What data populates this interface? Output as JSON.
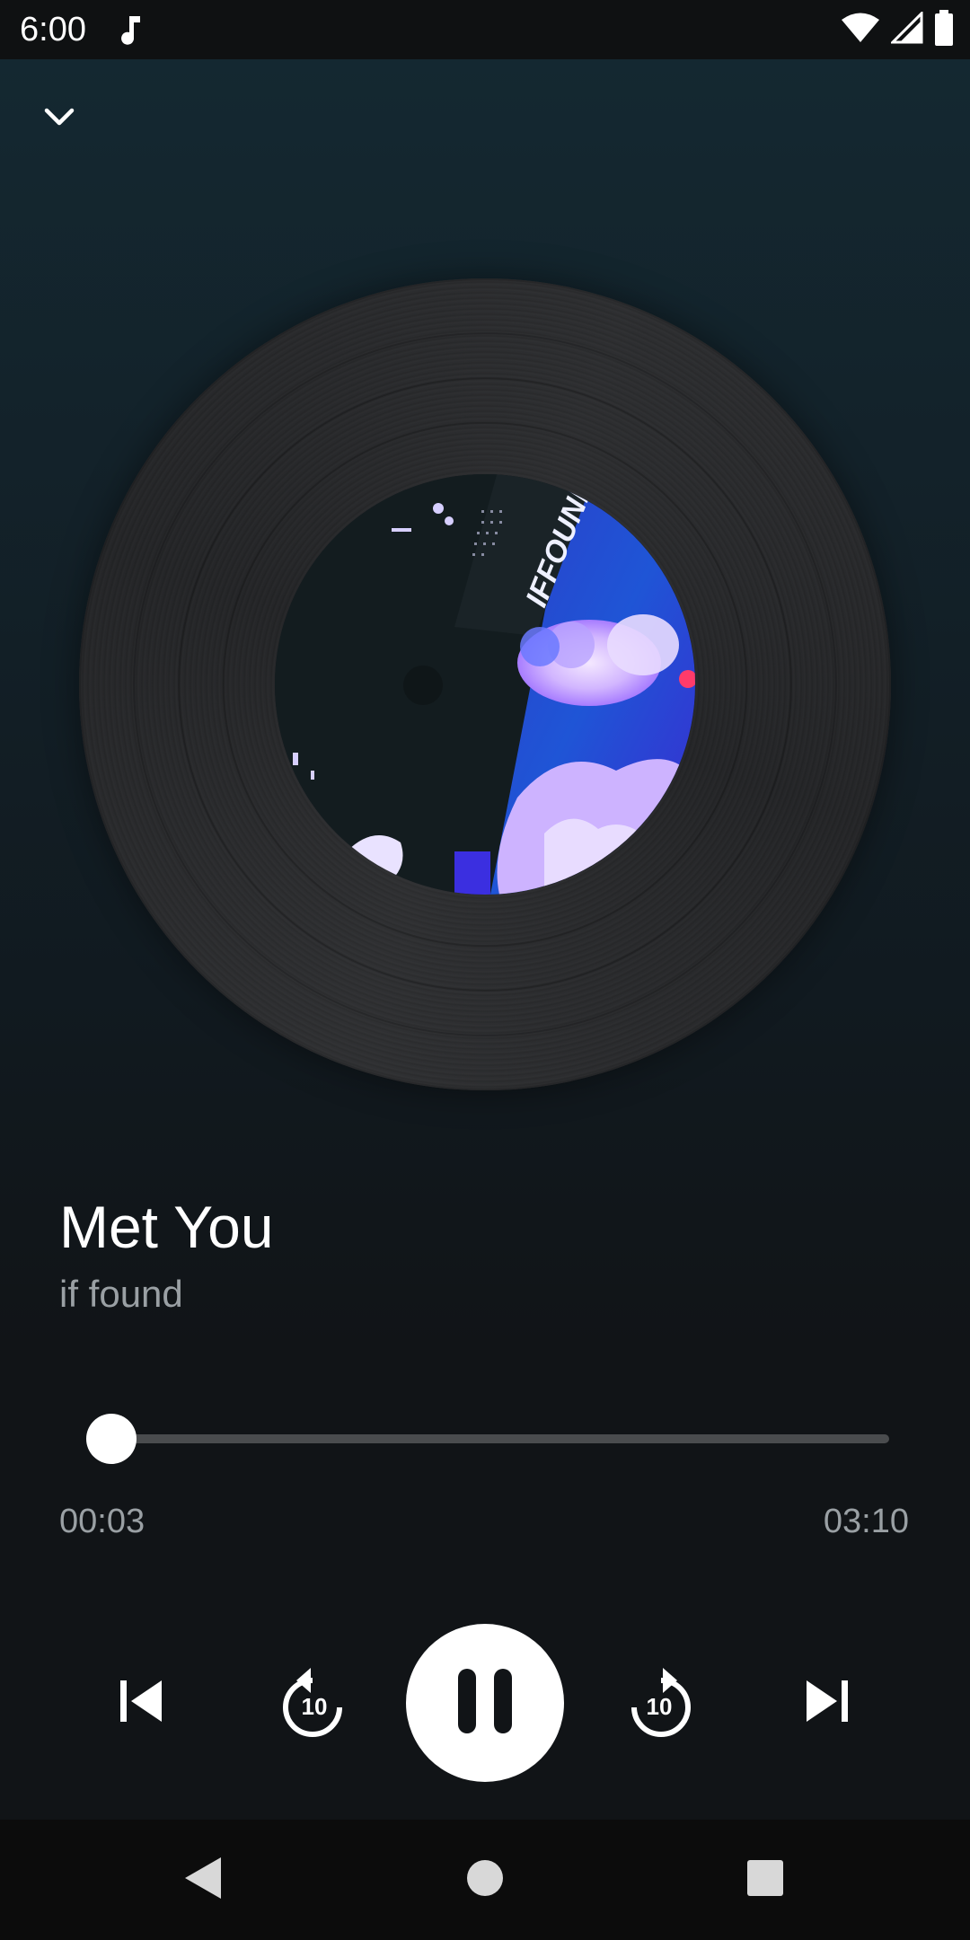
{
  "status_bar": {
    "time": "6:00",
    "icons": [
      "music-note-icon",
      "wifi-icon",
      "cell-signal-icon",
      "battery-icon"
    ]
  },
  "header": {
    "collapse_icon": "chevron-down-icon"
  },
  "album_art": {
    "label_text": "IFFOUND"
  },
  "track": {
    "title": "Met You",
    "artist": "if found"
  },
  "progress": {
    "elapsed": "00:03",
    "total": "03:10",
    "fraction": 0.016
  },
  "controls": {
    "previous_icon": "skip-previous-icon",
    "rewind_icon": "replay-10-icon",
    "rewind_seconds": "10",
    "play_pause_icon": "pause-icon",
    "forward_icon": "forward-10-icon",
    "forward_seconds": "10",
    "next_icon": "skip-next-icon"
  },
  "nav_bar": {
    "back_icon": "back-triangle-icon",
    "home_icon": "home-circle-icon",
    "recents_icon": "recents-square-icon"
  },
  "colors": {
    "background_top": "#142932",
    "background_bottom": "#111417",
    "accent": "#ffffff",
    "secondary_text": "#9aa0a4",
    "track": "#4a4c4e"
  }
}
